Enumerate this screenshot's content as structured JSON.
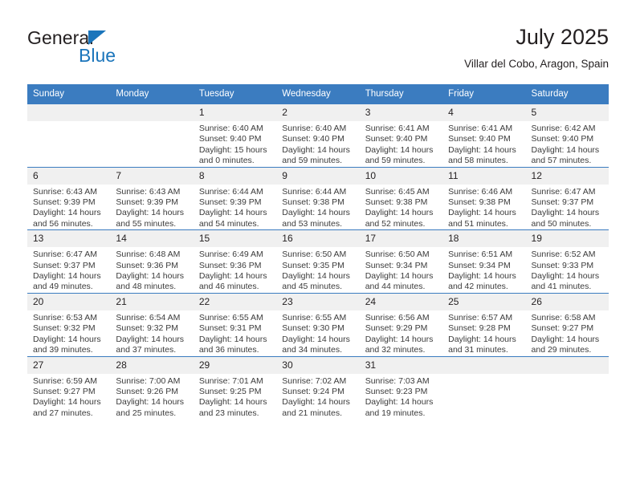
{
  "brand": {
    "name_line1": "General",
    "name_line2": "Blue",
    "logo_icon": "triangle-flag-icon",
    "accent_color": "#1b75bb",
    "text_color": "#231f20"
  },
  "header": {
    "title": "July 2025",
    "subtitle": "Villar del Cobo, Aragon, Spain"
  },
  "theme": {
    "header_blue": "#3b7cc0",
    "daynum_gray": "#f0f0f0",
    "body_text": "#3b3b3b"
  },
  "calendar": {
    "weekday_headers": [
      "Sunday",
      "Monday",
      "Tuesday",
      "Wednesday",
      "Thursday",
      "Friday",
      "Saturday"
    ],
    "weeks": [
      [
        {
          "day": "",
          "blank": true,
          "sunrise": "",
          "sunset": "",
          "daylight1": "",
          "daylight2": ""
        },
        {
          "day": "",
          "blank": true,
          "sunrise": "",
          "sunset": "",
          "daylight1": "",
          "daylight2": ""
        },
        {
          "day": "1",
          "sunrise": "Sunrise: 6:40 AM",
          "sunset": "Sunset: 9:40 PM",
          "daylight1": "Daylight: 15 hours",
          "daylight2": "and 0 minutes."
        },
        {
          "day": "2",
          "sunrise": "Sunrise: 6:40 AM",
          "sunset": "Sunset: 9:40 PM",
          "daylight1": "Daylight: 14 hours",
          "daylight2": "and 59 minutes."
        },
        {
          "day": "3",
          "sunrise": "Sunrise: 6:41 AM",
          "sunset": "Sunset: 9:40 PM",
          "daylight1": "Daylight: 14 hours",
          "daylight2": "and 59 minutes."
        },
        {
          "day": "4",
          "sunrise": "Sunrise: 6:41 AM",
          "sunset": "Sunset: 9:40 PM",
          "daylight1": "Daylight: 14 hours",
          "daylight2": "and 58 minutes."
        },
        {
          "day": "5",
          "sunrise": "Sunrise: 6:42 AM",
          "sunset": "Sunset: 9:40 PM",
          "daylight1": "Daylight: 14 hours",
          "daylight2": "and 57 minutes."
        }
      ],
      [
        {
          "day": "6",
          "sunrise": "Sunrise: 6:43 AM",
          "sunset": "Sunset: 9:39 PM",
          "daylight1": "Daylight: 14 hours",
          "daylight2": "and 56 minutes."
        },
        {
          "day": "7",
          "sunrise": "Sunrise: 6:43 AM",
          "sunset": "Sunset: 9:39 PM",
          "daylight1": "Daylight: 14 hours",
          "daylight2": "and 55 minutes."
        },
        {
          "day": "8",
          "sunrise": "Sunrise: 6:44 AM",
          "sunset": "Sunset: 9:39 PM",
          "daylight1": "Daylight: 14 hours",
          "daylight2": "and 54 minutes."
        },
        {
          "day": "9",
          "sunrise": "Sunrise: 6:44 AM",
          "sunset": "Sunset: 9:38 PM",
          "daylight1": "Daylight: 14 hours",
          "daylight2": "and 53 minutes."
        },
        {
          "day": "10",
          "sunrise": "Sunrise: 6:45 AM",
          "sunset": "Sunset: 9:38 PM",
          "daylight1": "Daylight: 14 hours",
          "daylight2": "and 52 minutes."
        },
        {
          "day": "11",
          "sunrise": "Sunrise: 6:46 AM",
          "sunset": "Sunset: 9:38 PM",
          "daylight1": "Daylight: 14 hours",
          "daylight2": "and 51 minutes."
        },
        {
          "day": "12",
          "sunrise": "Sunrise: 6:47 AM",
          "sunset": "Sunset: 9:37 PM",
          "daylight1": "Daylight: 14 hours",
          "daylight2": "and 50 minutes."
        }
      ],
      [
        {
          "day": "13",
          "sunrise": "Sunrise: 6:47 AM",
          "sunset": "Sunset: 9:37 PM",
          "daylight1": "Daylight: 14 hours",
          "daylight2": "and 49 minutes."
        },
        {
          "day": "14",
          "sunrise": "Sunrise: 6:48 AM",
          "sunset": "Sunset: 9:36 PM",
          "daylight1": "Daylight: 14 hours",
          "daylight2": "and 48 minutes."
        },
        {
          "day": "15",
          "sunrise": "Sunrise: 6:49 AM",
          "sunset": "Sunset: 9:36 PM",
          "daylight1": "Daylight: 14 hours",
          "daylight2": "and 46 minutes."
        },
        {
          "day": "16",
          "sunrise": "Sunrise: 6:50 AM",
          "sunset": "Sunset: 9:35 PM",
          "daylight1": "Daylight: 14 hours",
          "daylight2": "and 45 minutes."
        },
        {
          "day": "17",
          "sunrise": "Sunrise: 6:50 AM",
          "sunset": "Sunset: 9:34 PM",
          "daylight1": "Daylight: 14 hours",
          "daylight2": "and 44 minutes."
        },
        {
          "day": "18",
          "sunrise": "Sunrise: 6:51 AM",
          "sunset": "Sunset: 9:34 PM",
          "daylight1": "Daylight: 14 hours",
          "daylight2": "and 42 minutes."
        },
        {
          "day": "19",
          "sunrise": "Sunrise: 6:52 AM",
          "sunset": "Sunset: 9:33 PM",
          "daylight1": "Daylight: 14 hours",
          "daylight2": "and 41 minutes."
        }
      ],
      [
        {
          "day": "20",
          "sunrise": "Sunrise: 6:53 AM",
          "sunset": "Sunset: 9:32 PM",
          "daylight1": "Daylight: 14 hours",
          "daylight2": "and 39 minutes."
        },
        {
          "day": "21",
          "sunrise": "Sunrise: 6:54 AM",
          "sunset": "Sunset: 9:32 PM",
          "daylight1": "Daylight: 14 hours",
          "daylight2": "and 37 minutes."
        },
        {
          "day": "22",
          "sunrise": "Sunrise: 6:55 AM",
          "sunset": "Sunset: 9:31 PM",
          "daylight1": "Daylight: 14 hours",
          "daylight2": "and 36 minutes."
        },
        {
          "day": "23",
          "sunrise": "Sunrise: 6:55 AM",
          "sunset": "Sunset: 9:30 PM",
          "daylight1": "Daylight: 14 hours",
          "daylight2": "and 34 minutes."
        },
        {
          "day": "24",
          "sunrise": "Sunrise: 6:56 AM",
          "sunset": "Sunset: 9:29 PM",
          "daylight1": "Daylight: 14 hours",
          "daylight2": "and 32 minutes."
        },
        {
          "day": "25",
          "sunrise": "Sunrise: 6:57 AM",
          "sunset": "Sunset: 9:28 PM",
          "daylight1": "Daylight: 14 hours",
          "daylight2": "and 31 minutes."
        },
        {
          "day": "26",
          "sunrise": "Sunrise: 6:58 AM",
          "sunset": "Sunset: 9:27 PM",
          "daylight1": "Daylight: 14 hours",
          "daylight2": "and 29 minutes."
        }
      ],
      [
        {
          "day": "27",
          "sunrise": "Sunrise: 6:59 AM",
          "sunset": "Sunset: 9:27 PM",
          "daylight1": "Daylight: 14 hours",
          "daylight2": "and 27 minutes."
        },
        {
          "day": "28",
          "sunrise": "Sunrise: 7:00 AM",
          "sunset": "Sunset: 9:26 PM",
          "daylight1": "Daylight: 14 hours",
          "daylight2": "and 25 minutes."
        },
        {
          "day": "29",
          "sunrise": "Sunrise: 7:01 AM",
          "sunset": "Sunset: 9:25 PM",
          "daylight1": "Daylight: 14 hours",
          "daylight2": "and 23 minutes."
        },
        {
          "day": "30",
          "sunrise": "Sunrise: 7:02 AM",
          "sunset": "Sunset: 9:24 PM",
          "daylight1": "Daylight: 14 hours",
          "daylight2": "and 21 minutes."
        },
        {
          "day": "31",
          "sunrise": "Sunrise: 7:03 AM",
          "sunset": "Sunset: 9:23 PM",
          "daylight1": "Daylight: 14 hours",
          "daylight2": "and 19 minutes."
        },
        {
          "day": "",
          "blank": true,
          "sunrise": "",
          "sunset": "",
          "daylight1": "",
          "daylight2": ""
        },
        {
          "day": "",
          "blank": true,
          "sunrise": "",
          "sunset": "",
          "daylight1": "",
          "daylight2": ""
        }
      ]
    ]
  }
}
